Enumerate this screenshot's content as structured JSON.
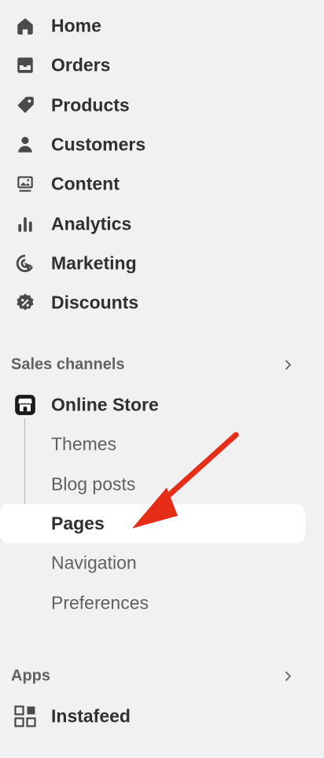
{
  "nav": {
    "items": [
      {
        "label": "Home",
        "icon": "home-icon"
      },
      {
        "label": "Orders",
        "icon": "inbox-icon"
      },
      {
        "label": "Products",
        "icon": "tag-icon"
      },
      {
        "label": "Customers",
        "icon": "person-icon"
      },
      {
        "label": "Content",
        "icon": "image-monitor-icon"
      },
      {
        "label": "Analytics",
        "icon": "bar-chart-icon"
      },
      {
        "label": "Marketing",
        "icon": "target-cursor-icon"
      },
      {
        "label": "Discounts",
        "icon": "discount-badge-icon"
      }
    ]
  },
  "sales_channels": {
    "title": "Sales channels",
    "online_store": {
      "label": "Online Store",
      "icon": "storefront-icon"
    },
    "sub_items": [
      {
        "label": "Themes"
      },
      {
        "label": "Blog posts"
      },
      {
        "label": "Pages",
        "active": true
      },
      {
        "label": "Navigation"
      },
      {
        "label": "Preferences"
      }
    ]
  },
  "apps": {
    "title": "Apps",
    "items": [
      {
        "label": "Instafeed",
        "icon": "apps-grid-icon"
      }
    ]
  },
  "annotation": {
    "color": "#e52d17"
  }
}
